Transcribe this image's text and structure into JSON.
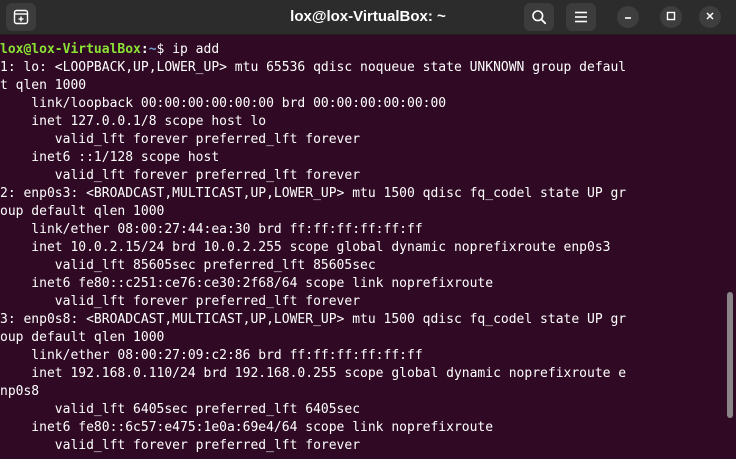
{
  "window": {
    "title": "lox@lox-VirtualBox: ~"
  },
  "titlebar": {
    "new_tab_icon": "new-tab-icon",
    "search_icon": "search-icon",
    "menu_icon": "hamburger-menu-icon",
    "minimize_icon": "minimize-icon",
    "maximize_icon": "maximize-icon",
    "close_icon": "close-icon"
  },
  "colors": {
    "terminal_bg": "#300a24",
    "titlebar_bg": "#2c2c2c",
    "prompt_user": "#8ae234",
    "prompt_path": "#729fcf",
    "text": "#ffffff"
  },
  "terminal": {
    "prompt": {
      "user_host": "lox@lox-VirtualBox",
      "separator": ":",
      "path": "~",
      "symbol": "$ ",
      "command": "ip add"
    },
    "output": [
      "1: lo: <LOOPBACK,UP,LOWER_UP> mtu 65536 qdisc noqueue state UNKNOWN group defaul",
      "t qlen 1000",
      "    link/loopback 00:00:00:00:00:00 brd 00:00:00:00:00:00",
      "    inet 127.0.0.1/8 scope host lo",
      "       valid_lft forever preferred_lft forever",
      "    inet6 ::1/128 scope host",
      "       valid_lft forever preferred_lft forever",
      "2: enp0s3: <BROADCAST,MULTICAST,UP,LOWER_UP> mtu 1500 qdisc fq_codel state UP gr",
      "oup default qlen 1000",
      "    link/ether 08:00:27:44:ea:30 brd ff:ff:ff:ff:ff:ff",
      "    inet 10.0.2.15/24 brd 10.0.2.255 scope global dynamic noprefixroute enp0s3",
      "       valid_lft 85605sec preferred_lft 85605sec",
      "    inet6 fe80::c251:ce76:ce30:2f68/64 scope link noprefixroute",
      "       valid_lft forever preferred_lft forever",
      "3: enp0s8: <BROADCAST,MULTICAST,UP,LOWER_UP> mtu 1500 qdisc fq_codel state UP gr",
      "oup default qlen 1000",
      "    link/ether 08:00:27:09:c2:86 brd ff:ff:ff:ff:ff:ff",
      "    inet 192.168.0.110/24 brd 192.168.0.255 scope global dynamic noprefixroute e",
      "np0s8",
      "       valid_lft 6405sec preferred_lft 6405sec",
      "    inet6 fe80::6c57:e475:1e0a:69e4/64 scope link noprefixroute",
      "       valid_lft forever preferred_lft forever"
    ]
  }
}
